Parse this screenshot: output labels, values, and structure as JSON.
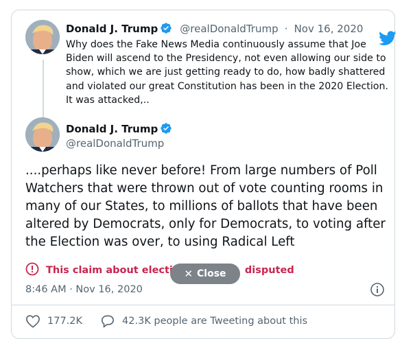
{
  "parent_tweet": {
    "name": "Donald J. Trump",
    "handle": "@realDonaldTrump",
    "separator": "·",
    "date": "Nov 16, 2020",
    "text": "Why does the Fake News Media continuously assume that Joe Biden will ascend to the Presidency, not even allowing our side to show, which we are just getting ready to do, how badly shattered and violated our great Constitution has been in the 2020 Election. It was attacked,.."
  },
  "main_tweet": {
    "name": "Donald J. Trump",
    "handle": "@realDonaldTrump",
    "text": "....perhaps like never before! From large numbers of Poll Watchers that were thrown out of vote counting rooms in many of our States, to millions of ballots that have been altered by Democrats, only for Democrats, to voting after the Election was over, to using Radical Left",
    "dispute_left": "This claim about electi",
    "dispute_right": "disputed",
    "timestamp": "8:46 AM · Nov 16, 2020"
  },
  "overlay": {
    "close_label": "Close"
  },
  "actions": {
    "likes": "177.2K",
    "conversation": "42.3K people are Tweeting about this"
  },
  "colors": {
    "brand": "#1d9bf0",
    "dispute": "#c7264f",
    "muted": "#536471"
  },
  "icons": {
    "brand": "twitter-bird-icon",
    "verified": "verified-badge-icon",
    "dispute": "alert-circle-icon",
    "close": "close-x-icon",
    "info": "info-icon",
    "like": "heart-icon",
    "reply": "speech-bubble-icon"
  }
}
